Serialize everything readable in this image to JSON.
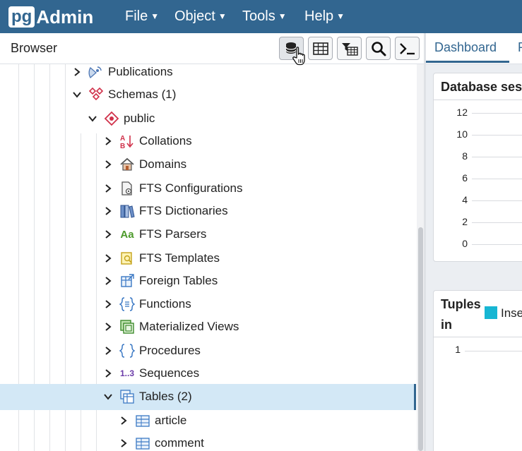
{
  "app": {
    "logo_pg": "pg",
    "logo_admin": "Admin"
  },
  "menu": [
    {
      "label": "File"
    },
    {
      "label": "Object"
    },
    {
      "label": "Tools"
    },
    {
      "label": "Help"
    }
  ],
  "browser": {
    "title": "Browser"
  },
  "toolbar": {
    "buttons": [
      {
        "icon": "database-query-icon"
      },
      {
        "icon": "table-view-icon"
      },
      {
        "icon": "filter-table-icon"
      },
      {
        "icon": "search-icon"
      },
      {
        "icon": "terminal-icon"
      }
    ]
  },
  "tree": {
    "items": [
      {
        "label": "Publications",
        "icon": "publications-icon",
        "expanded": false
      },
      {
        "label": "Schemas (1)",
        "icon": "schemas-icon",
        "expanded": true
      },
      {
        "label": "public",
        "icon": "schema-icon",
        "expanded": true
      },
      {
        "label": "Collations",
        "icon": "collations-icon",
        "expanded": false
      },
      {
        "label": "Domains",
        "icon": "domains-icon",
        "expanded": false
      },
      {
        "label": "FTS Configurations",
        "icon": "fts-configurations-icon",
        "expanded": false
      },
      {
        "label": "FTS Dictionaries",
        "icon": "fts-dictionaries-icon",
        "expanded": false
      },
      {
        "label": "FTS Parsers",
        "icon": "fts-parsers-icon",
        "expanded": false
      },
      {
        "label": "FTS Templates",
        "icon": "fts-templates-icon",
        "expanded": false
      },
      {
        "label": "Foreign Tables",
        "icon": "foreign-tables-icon",
        "expanded": false
      },
      {
        "label": "Functions",
        "icon": "functions-icon",
        "expanded": false
      },
      {
        "label": "Materialized Views",
        "icon": "materialized-views-icon",
        "expanded": false
      },
      {
        "label": "Procedures",
        "icon": "procedures-icon",
        "expanded": false
      },
      {
        "label": "Sequences",
        "icon": "sequences-icon",
        "expanded": false
      },
      {
        "label": "Tables (2)",
        "icon": "tables-icon",
        "expanded": true,
        "selected": true
      },
      {
        "label": "article",
        "icon": "table-icon",
        "expanded": false
      },
      {
        "label": "comment",
        "icon": "table-icon",
        "expanded": false
      }
    ],
    "parsers_glyph": "Aa",
    "sequences_glyph": "1..3"
  },
  "right": {
    "tabs": [
      {
        "label": "Dashboard"
      },
      {
        "label": "P"
      }
    ],
    "sessions_card": {
      "title": "Database ses",
      "yticks": [
        "12",
        "10",
        "8",
        "6",
        "4",
        "2",
        "0"
      ]
    },
    "tuples_card": {
      "title_line1": "Tuples",
      "title_line2": "in",
      "legend_label": "Inse",
      "ytick": "1"
    }
  },
  "colors": {
    "brand": "#326690",
    "selected_row": "#d3e8f6",
    "legend_insert": "#17b6d3"
  }
}
